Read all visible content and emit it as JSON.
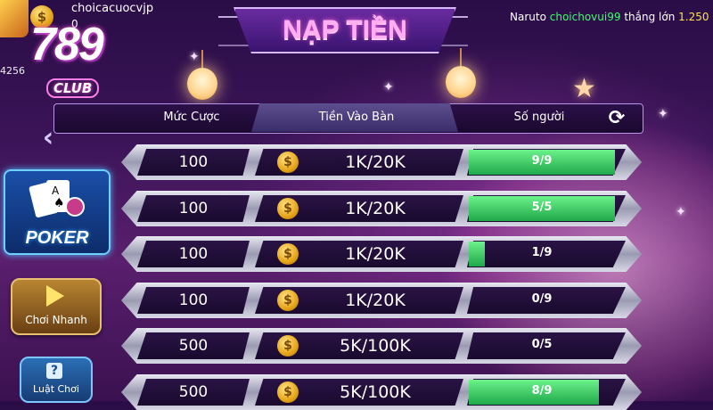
{
  "profile": {
    "username": "choicacuocvjp",
    "balance": "0",
    "side_balance": "4256",
    "coin_symbol": "$"
  },
  "logo": {
    "number": "789",
    "club": "CLUB"
  },
  "banner": {
    "title": "NẠP TIỀN"
  },
  "ticker": {
    "name": "Naruto",
    "highlight": "choichovui99",
    "text": "thắng lớn",
    "amount": "1.250"
  },
  "table_header": {
    "col1": "Mức Cược",
    "col2": "Tiền Vào Bàn",
    "col3": "Số người"
  },
  "side": {
    "poker_label": "POKER",
    "quick_play": "Chơi Nhanh",
    "rules": "Luật Chơi",
    "rules_icon": "?"
  },
  "colors": {
    "fill_green": "#3ed466",
    "banner_pink": "#ffb0f0",
    "ticker_green": "#3dff6a",
    "ticker_yellow": "#ffe24a"
  },
  "rows": [
    {
      "bet": "100",
      "buyin": "1K/20K",
      "players": "9/9",
      "fill": 1.0
    },
    {
      "bet": "100",
      "buyin": "1K/20K",
      "players": "5/5",
      "fill": 1.0
    },
    {
      "bet": "100",
      "buyin": "1K/20K",
      "players": "1/9",
      "fill": 0.111
    },
    {
      "bet": "100",
      "buyin": "1K/20K",
      "players": "0/9",
      "fill": 0.0
    },
    {
      "bet": "500",
      "buyin": "5K/100K",
      "players": "0/5",
      "fill": 0.0
    },
    {
      "bet": "500",
      "buyin": "5K/100K",
      "players": "8/9",
      "fill": 0.889
    }
  ]
}
